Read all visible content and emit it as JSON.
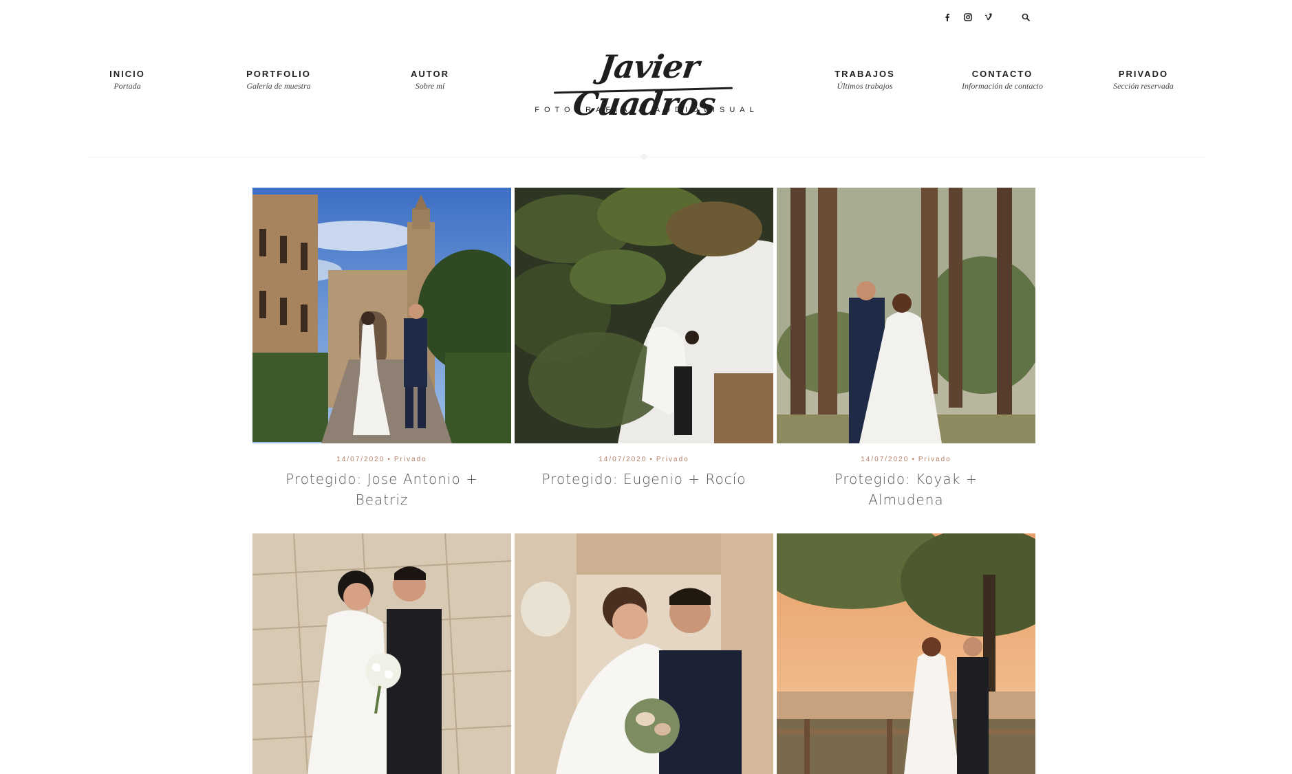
{
  "social": {
    "items": [
      {
        "name": "facebook",
        "glyph": "f"
      },
      {
        "name": "instagram",
        "glyph": "◘"
      },
      {
        "name": "vimeo",
        "glyph": "v"
      }
    ],
    "search_icon": "search-icon"
  },
  "logo": {
    "script": "Javier Cuadros",
    "tagline": "FOTOGRAFÍA & AUDIOVISUAL"
  },
  "nav": {
    "left": [
      {
        "label": "INICIO",
        "sub": "Portada"
      },
      {
        "label": "PORTFOLIO",
        "sub": "Galería de muestra"
      },
      {
        "label": "AUTOR",
        "sub": "Sobre mí"
      }
    ],
    "right": [
      {
        "label": "TRABAJOS",
        "sub": "Últimos trabajos"
      },
      {
        "label": "CONTACTO",
        "sub": "Información de contacto"
      },
      {
        "label": "PRIVADO",
        "sub": "Sección reservada"
      }
    ]
  },
  "posts": [
    {
      "date": "14/07/2020",
      "category": "Privado",
      "title": "Protegido: Jose Antonio + Beatriz",
      "photo": "cathedral-square-couple"
    },
    {
      "date": "14/07/2020",
      "category": "Privado",
      "title": "Protegido: Eugenio + Rocío",
      "photo": "foliage-white-wall-couple"
    },
    {
      "date": "14/07/2020",
      "category": "Privado",
      "title": "Protegido: Koyak + Almudena",
      "photo": "pine-forest-couple"
    },
    {
      "photo": "stone-floor-couple-bouquet"
    },
    {
      "photo": "stone-column-embrace"
    },
    {
      "photo": "sunset-fence-couple"
    }
  ],
  "colors": {
    "accent_meta": "#b07d62",
    "text_dark": "#222222",
    "title_gray": "#555555"
  }
}
